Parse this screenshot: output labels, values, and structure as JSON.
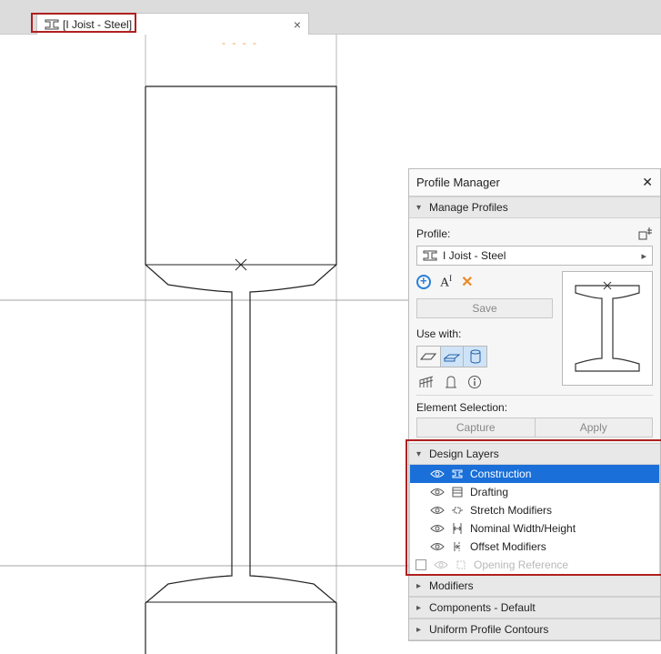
{
  "tab": {
    "title": "[I Joist - Steel]"
  },
  "panel": {
    "title": "Profile Manager",
    "sections": {
      "manage": "Manage Profiles",
      "design_layers": "Design Layers",
      "modifiers": "Modifiers",
      "components": "Components - Default",
      "contours": "Uniform Profile Contours"
    },
    "profile_label": "Profile:",
    "profile_name": "I Joist - Steel",
    "save": "Save",
    "use_with": "Use with:",
    "element_selection": "Element Selection:",
    "capture": "Capture",
    "apply": "Apply"
  },
  "layers": {
    "items": [
      {
        "label": "Construction"
      },
      {
        "label": "Drafting"
      },
      {
        "label": "Stretch Modifiers"
      },
      {
        "label": "Nominal Width/Height"
      },
      {
        "label": "Offset Modifiers"
      },
      {
        "label": "Opening Reference"
      }
    ]
  }
}
